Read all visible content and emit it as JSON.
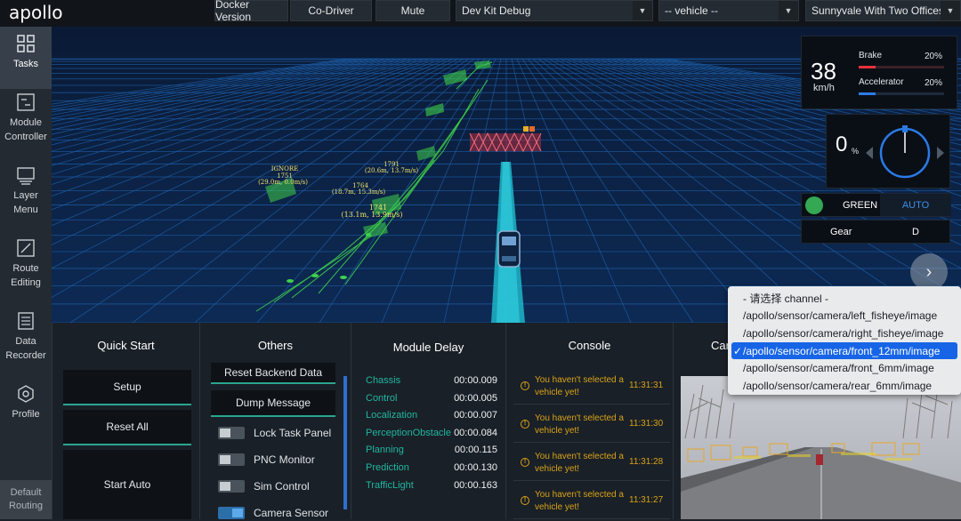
{
  "app": {
    "logo": "apollo"
  },
  "toolbar": {
    "docker_version": "Docker Version",
    "co_driver": "Co-Driver",
    "mute": "Mute",
    "mode_select": "Dev Kit Debug",
    "vehicle_select": "-- vehicle --",
    "map_select": "Sunnyvale With Two Offices"
  },
  "sidebar": {
    "items": [
      {
        "label": "Tasks",
        "icon": "grid-icon"
      },
      {
        "label": "Module Controller",
        "icon": "module-controller-icon"
      },
      {
        "label": "Layer Menu",
        "icon": "layer-menu-icon"
      },
      {
        "label": "Route Editing",
        "icon": "route-editing-icon"
      },
      {
        "label": "Data Recorder",
        "icon": "data-recorder-icon"
      },
      {
        "label": "Profile",
        "icon": "hexagon-icon"
      }
    ],
    "default_routing": "Default Routing"
  },
  "scene": {
    "labels": [
      {
        "text": "IGNORE"
      },
      {
        "text": "1751"
      },
      {
        "text": "(29.0m, 0.0m/s)"
      },
      {
        "text": "1791"
      },
      {
        "text": "(20.6m, 13.7m/s)"
      },
      {
        "text": "1764"
      },
      {
        "text": "(18.7m, 15.3m/s)"
      },
      {
        "text": "1741"
      },
      {
        "text": "(13.1m, 13.9m/s)"
      }
    ]
  },
  "dashboard": {
    "speed": "38",
    "speed_unit": "km/h",
    "brake_label": "Brake",
    "brake_value": "20%",
    "brake_fraction": 0.2,
    "accelerator_label": "Accelerator",
    "accelerator_value": "20%",
    "accelerator_fraction": 0.2,
    "steering": "0",
    "steering_unit": "%",
    "signal": "GREEN",
    "signal_color": "#34a853",
    "mode": "AUTO",
    "gear_label": "Gear",
    "gear_value": "D"
  },
  "quick_start": {
    "title": "Quick Start",
    "setup": "Setup",
    "reset_all": "Reset All",
    "start_auto": "Start Auto"
  },
  "others": {
    "title": "Others",
    "reset_backend": "Reset Backend Data",
    "dump_message": "Dump Message",
    "toggles": [
      {
        "label": "Lock Task Panel",
        "on": false
      },
      {
        "label": "PNC Monitor",
        "on": false
      },
      {
        "label": "Sim Control",
        "on": false
      },
      {
        "label": "Camera Sensor",
        "on": true
      }
    ]
  },
  "module_delay": {
    "title": "Module Delay",
    "rows": [
      {
        "name": "Chassis",
        "value": "00:00.009"
      },
      {
        "name": "Control",
        "value": "00:00.005"
      },
      {
        "name": "Localization",
        "value": "00:00.007"
      },
      {
        "name": "PerceptionObstacle",
        "value": "00:00.084"
      },
      {
        "name": "Planning",
        "value": "00:00.115"
      },
      {
        "name": "Prediction",
        "value": "00:00.130"
      },
      {
        "name": "TrafficLight",
        "value": "00:00.163"
      }
    ]
  },
  "console": {
    "title": "Console",
    "rows": [
      {
        "message": "You haven't selected a vehicle yet!",
        "time": "11:31:31"
      },
      {
        "message": "You haven't selected a vehicle yet!",
        "time": "11:31:30"
      },
      {
        "message": "You haven't selected a vehicle yet!",
        "time": "11:31:28"
      },
      {
        "message": "You haven't selected a vehicle yet!",
        "time": "11:31:27"
      }
    ]
  },
  "camera_view": {
    "title_partial": "Car"
  },
  "channel_menu": {
    "options": [
      {
        "label": "- 请选择 channel -",
        "selected": false
      },
      {
        "label": "/apollo/sensor/camera/left_fisheye/image",
        "selected": false
      },
      {
        "label": "/apollo/sensor/camera/right_fisheye/image",
        "selected": false
      },
      {
        "label": "/apollo/sensor/camera/front_12mm/image",
        "selected": true
      },
      {
        "label": "/apollo/sensor/camera/front_6mm/image",
        "selected": false
      },
      {
        "label": "/apollo/sensor/camera/rear_6mm/image",
        "selected": false
      }
    ],
    "check_glyph": "✓"
  },
  "colors": {
    "accent_teal": "#2aa58f",
    "delay_name": "#20b6a1",
    "warning": "#d8a319",
    "menu_selected": "#1765e6",
    "grid": "#1d5ea8"
  }
}
